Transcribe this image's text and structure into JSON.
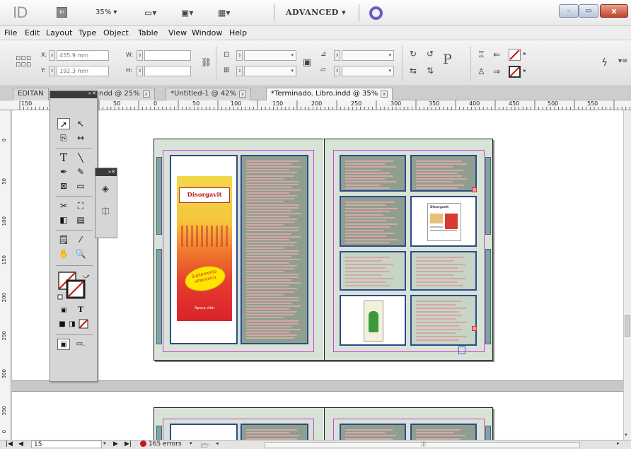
{
  "titlebar": {
    "app_logo": "ID",
    "bridge_label": "Br",
    "zoom": "35% ▾",
    "workspace": "ADVANCED ▾",
    "minimize": "–",
    "restore": "▭",
    "close": "x"
  },
  "menubar": {
    "items": [
      "File",
      "Edit",
      "Layout",
      "Type",
      "Object",
      "Table",
      "View",
      "Window",
      "Help"
    ]
  },
  "controlbar": {
    "x_label": "X:",
    "x_value": "455.9 mm",
    "y_label": "Y:",
    "y_value": "192.3 mm",
    "w_label": "W:",
    "h_label": "H:",
    "p_glyph": "P"
  },
  "tabs": [
    {
      "label": "EDITAN",
      "suffix": "ndd @ 25%",
      "active": false
    },
    {
      "label": "*Untitled-1 @ 42%",
      "active": false
    },
    {
      "label": "*Terminado. Libro.indd @ 35%",
      "active": true
    }
  ],
  "ruler": {
    "h_ticks": [
      "150",
      "100",
      "50",
      "0",
      "50",
      "100",
      "150",
      "200",
      "250",
      "300",
      "350",
      "400",
      "450",
      "500",
      "550"
    ],
    "v_ticks": [
      "0",
      "50",
      "100",
      "150",
      "200",
      "250",
      "300",
      "350",
      "0"
    ]
  },
  "cover": {
    "brand": "Disorgavit",
    "burst": "Suplemento vitamínico",
    "tagline": "Apoyo vital"
  },
  "small_book": {
    "title": "Disorgavit"
  },
  "status": {
    "page": "15",
    "errors": "165 errors",
    "first": "|◀",
    "prev": "◀",
    "next": "▶",
    "last": "▶|"
  },
  "colors": {
    "page_bg": "#d7e3d6",
    "frame_border": "#2d4a8a",
    "margin_guide": "#d93bd9",
    "error_dot": "#c8141e"
  }
}
